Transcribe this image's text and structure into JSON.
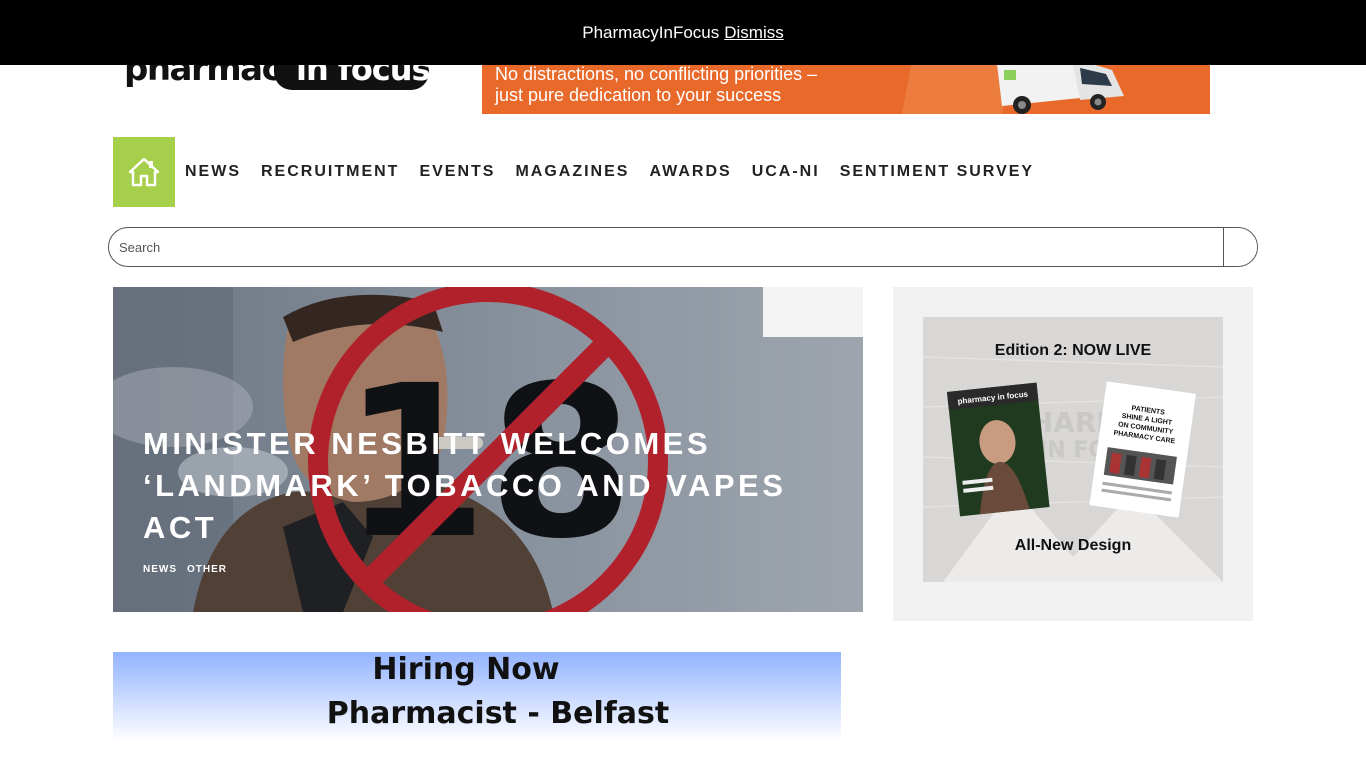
{
  "notice": {
    "text": "PharmacyInFocus",
    "dismiss": "Dismiss"
  },
  "logo": {
    "word1": "pharmacy",
    "word2": "in focus"
  },
  "top_ad": {
    "line1": "No distractions, no conflicting priorities –",
    "line2": "just pure dedication to your success"
  },
  "nav": {
    "home_icon": "home-icon",
    "items": [
      "NEWS",
      "RECRUITMENT",
      "EVENTS",
      "MAGAZINES",
      "AWARDS",
      "UCA-NI",
      "SENTIMENT SURVEY"
    ]
  },
  "search": {
    "placeholder": "Search",
    "button_icon": "search-icon"
  },
  "hero": {
    "title": "Minister Nesbitt welcomes ‘landmark’ Tobacco and Vapes Act",
    "sign_number": "18",
    "tags": [
      "NEWS",
      "OTHER"
    ]
  },
  "sidebar_ad": {
    "headline": "Edition 2: NOW LIVE",
    "footer": "All-New Design",
    "mag_brand": "pharmacy in focus",
    "news_headline": "PATIENTS SHINE A LIGHT ON COMMUNITY PHARMACY CARE"
  },
  "bottom_ad": {
    "line1": "Hiring Now",
    "line2": "Pharmacist - Belfast"
  },
  "colors": {
    "accent_green": "#a6cf4b",
    "ad_orange": "#e8692a",
    "no_sign_red": "#c8232b"
  }
}
